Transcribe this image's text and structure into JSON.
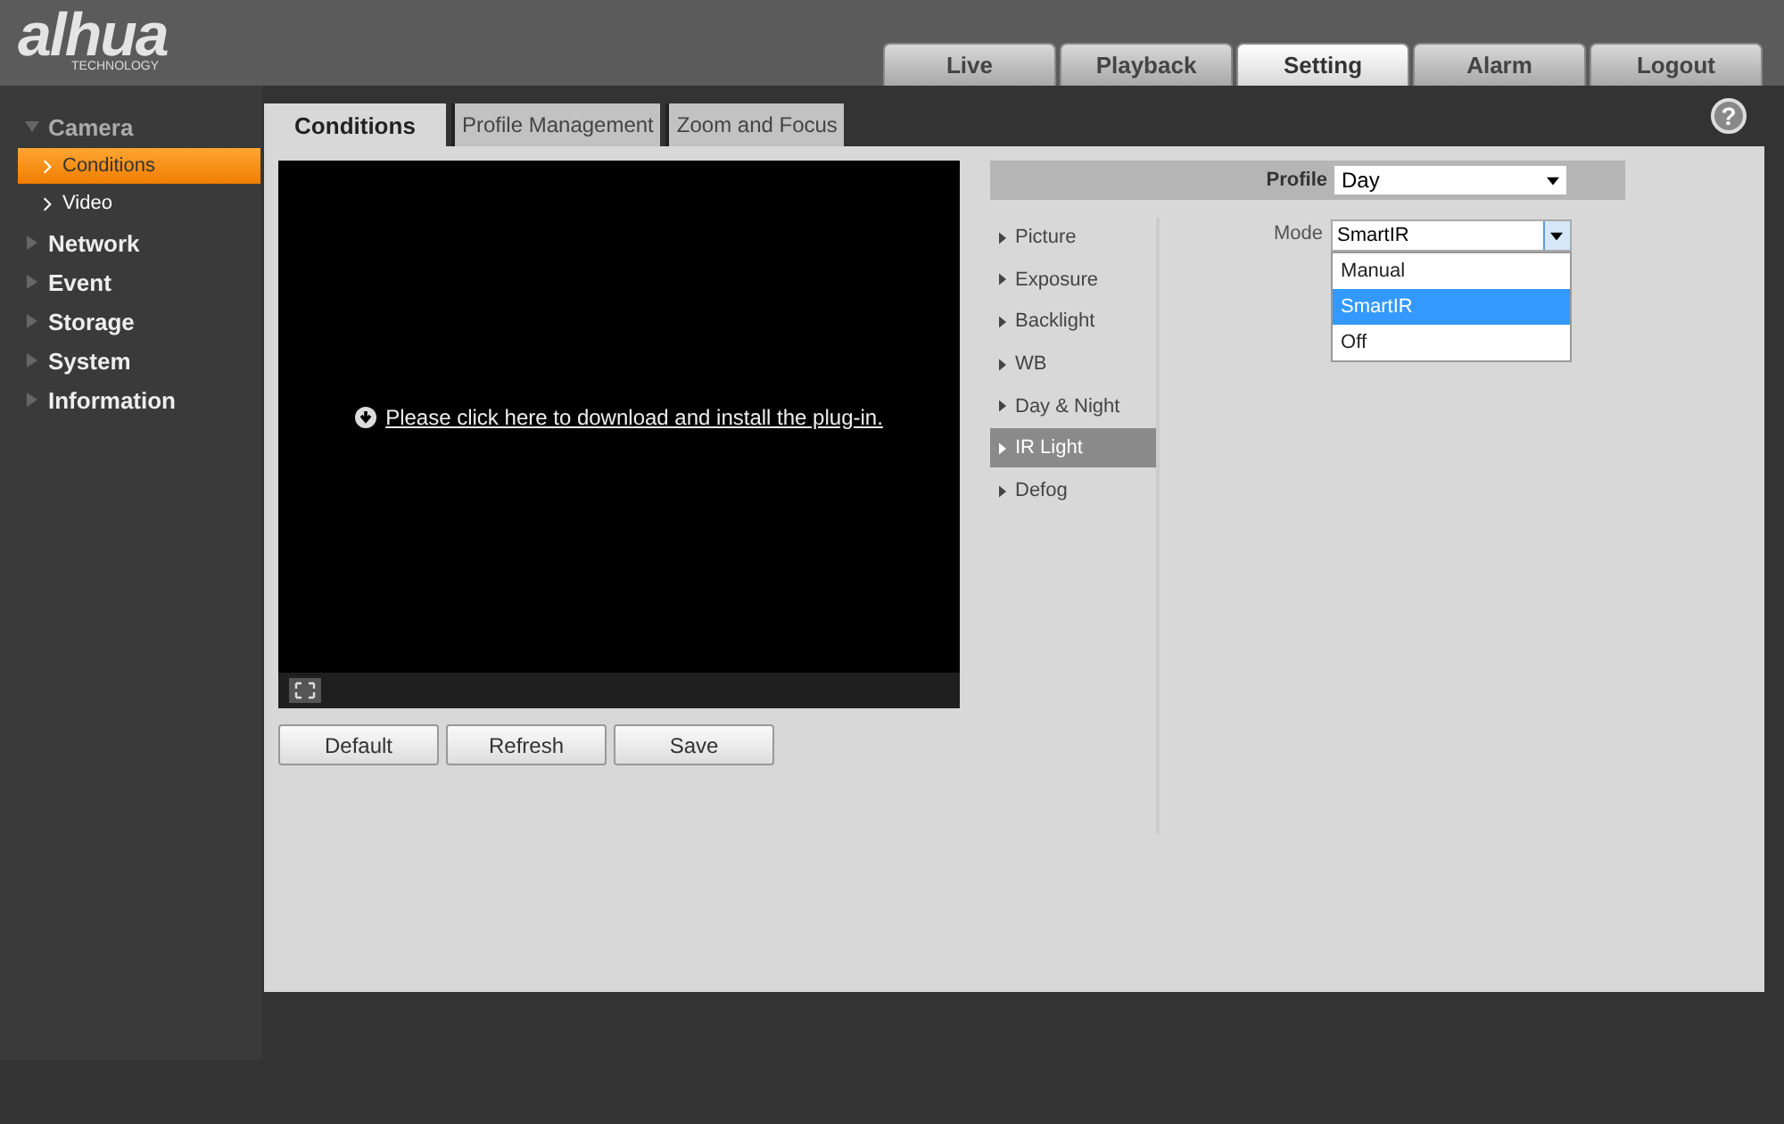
{
  "logo": {
    "brand": "alhua",
    "tagline": "TECHNOLOGY"
  },
  "top_tabs": [
    {
      "label": "Live",
      "selected": false
    },
    {
      "label": "Playback",
      "selected": false
    },
    {
      "label": "Setting",
      "selected": true
    },
    {
      "label": "Alarm",
      "selected": false
    },
    {
      "label": "Logout",
      "selected": false
    }
  ],
  "sidebar": {
    "items": [
      {
        "label": "Camera",
        "expanded": true,
        "children": [
          {
            "label": "Conditions",
            "selected": true
          },
          {
            "label": "Video",
            "selected": false
          }
        ]
      },
      {
        "label": "Network",
        "expanded": false
      },
      {
        "label": "Event",
        "expanded": false
      },
      {
        "label": "Storage",
        "expanded": false
      },
      {
        "label": "System",
        "expanded": false
      },
      {
        "label": "Information",
        "expanded": false
      }
    ]
  },
  "sub_tabs": [
    {
      "label": "Conditions",
      "selected": true
    },
    {
      "label": "Profile Management",
      "selected": false
    },
    {
      "label": "Zoom and Focus",
      "selected": false
    }
  ],
  "help": {
    "symbol": "?"
  },
  "video": {
    "plugin_link": "Please click here to download and install the plug-in."
  },
  "buttons": [
    "Default",
    "Refresh",
    "Save"
  ],
  "profile": {
    "label": "Profile",
    "value": "Day"
  },
  "categories": [
    {
      "label": "Picture",
      "selected": false
    },
    {
      "label": "Exposure",
      "selected": false
    },
    {
      "label": "Backlight",
      "selected": false
    },
    {
      "label": "WB",
      "selected": false
    },
    {
      "label": "Day & Night",
      "selected": false
    },
    {
      "label": "IR Light",
      "selected": true
    },
    {
      "label": "Defog",
      "selected": false
    }
  ],
  "mode": {
    "label": "Mode",
    "value": "SmartIR",
    "expanded": true,
    "options": [
      {
        "label": "Manual",
        "selected": false
      },
      {
        "label": "SmartIR",
        "selected": true
      },
      {
        "label": "Off",
        "selected": false
      }
    ]
  }
}
